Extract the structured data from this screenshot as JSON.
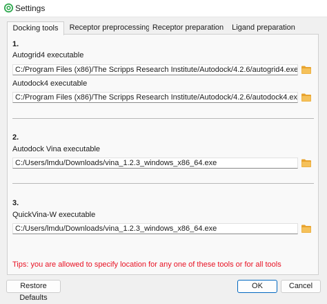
{
  "window": {
    "title": "Settings"
  },
  "tabs": [
    {
      "label": "Docking tools"
    },
    {
      "label": "Receptor preprocessing"
    },
    {
      "label": "Receptor preparation"
    },
    {
      "label": "Ligand preparation"
    }
  ],
  "sections": [
    {
      "number": "1.",
      "fields": [
        {
          "label": "Autogrid4 executable",
          "value": "C:/Program Files (x86)/The Scripps Research Institute/Autodock/4.2.6/autogrid4.exe"
        },
        {
          "label": "Autodock4 executable",
          "value": "C:/Program Files (x86)/The Scripps Research Institute/Autodock/4.2.6/autodock4.exe"
        }
      ]
    },
    {
      "number": "2.",
      "fields": [
        {
          "label": "Autodock Vina executable",
          "value": "C:/Users/lmdu/Downloads/vina_1.2.3_windows_x86_64.exe"
        }
      ]
    },
    {
      "number": "3.",
      "fields": [
        {
          "label": "QuickVina-W executable",
          "value": "C:/Users/lmdu/Downloads/vina_1.2.3_windows_x86_64.exe"
        }
      ]
    }
  ],
  "tips": "Tips: you are allowed to specify location for any one of these tools or for all tools",
  "buttons": {
    "restore": "Restore Defaults",
    "ok": "OK",
    "cancel": "Cancel"
  },
  "colors": {
    "folder": "#e8a32e",
    "tips": "#e81123",
    "accent": "#0067c0"
  },
  "icons": {
    "app": "settings-app-icon",
    "browse": "folder-icon"
  }
}
